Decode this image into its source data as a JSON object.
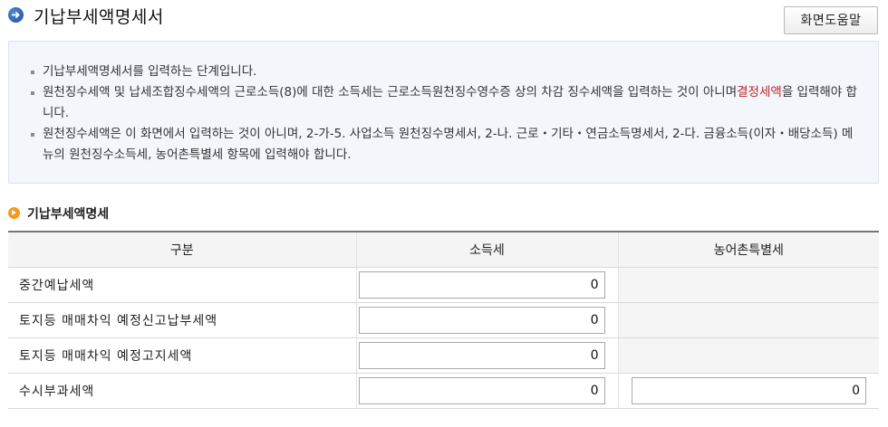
{
  "header": {
    "title": "기납부세액명세서",
    "help_button": "화면도움말"
  },
  "info": {
    "line1": "기납부세액명세서를 입력하는 단계입니다.",
    "line2_pre": "원천징수세액 및 납세조합징수세액의 근로소득(8)에 대한 소득세는 근로소득원천징수영수증 상의 차감 징수세액을 입력하는 것이 아니며",
    "line2_highlight": "결정세액",
    "line2_post": "을 입력해야 합니다.",
    "line3": "원천징수세액은 이 화면에서 입력하는 것이 아니며, 2-가-5. 사업소득 원천징수명세서, 2-나. 근로・기타・연금소득명세서, 2-다. 금융소득(이자・배당소득) 메뉴의 원천징수소득세, 농어촌특별세 항목에 입력해야 합니다."
  },
  "section": {
    "title": "기납부세액명세"
  },
  "table": {
    "headers": [
      "구분",
      "소득세",
      "농어촌특별세"
    ],
    "rows": [
      {
        "label": "중간예납세액",
        "income_tax": "0"
      },
      {
        "label": "토지등 매매차익 예정신고납부세액",
        "income_tax": "0"
      },
      {
        "label": "토지등 매매차익 예정고지세액",
        "income_tax": "0"
      },
      {
        "label": "수시부과세액",
        "income_tax": "0",
        "rural_tax": "0"
      }
    ]
  },
  "colors": {
    "highlight": "#c0272d",
    "info_bg": "#f3f6fb",
    "bullet_icon": "#f39a1e",
    "title_icon": "#2a5fae"
  }
}
